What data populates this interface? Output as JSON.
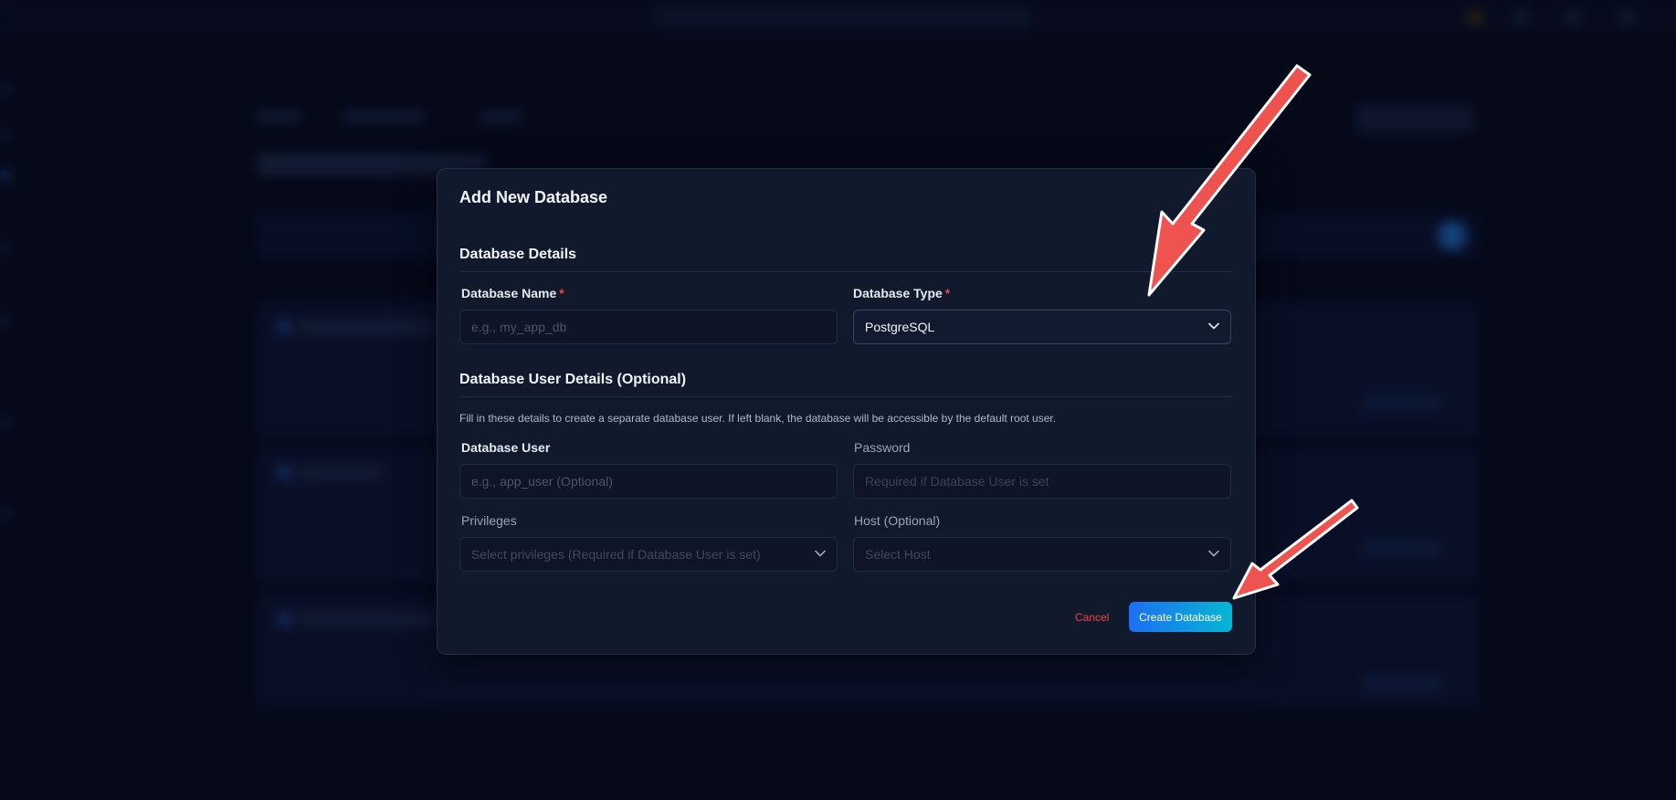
{
  "modal": {
    "title": "Add New Database",
    "details_section": {
      "title": "Database Details",
      "name_label": "Database Name",
      "name_placeholder": "e.g., my_app_db",
      "type_label": "Database Type",
      "type_value": "PostgreSQL",
      "required_mark": "*"
    },
    "user_section": {
      "title": "Database User Details (Optional)",
      "helper": "Fill in these details to create a separate database user. If left blank, the database will be accessible by the default root user.",
      "user_label": "Database User",
      "user_placeholder": "e.g., app_user (Optional)",
      "password_label": "Password",
      "password_placeholder": "Required if Database User is set",
      "privileges_label": "Privileges",
      "privileges_placeholder": "Select privileges (Required if Database User is set)",
      "host_label": "Host (Optional)",
      "host_placeholder": "Select Host"
    },
    "actions": {
      "cancel": "Cancel",
      "create": "Create Database"
    }
  },
  "colors": {
    "accent_gradient_start": "#1d6ff2",
    "accent_gradient_end": "#06b6d4",
    "danger": "#ef4444",
    "annotation_arrow": "#ef5350"
  },
  "icons": {
    "select_chevron": "chevron-down-icon",
    "annotation": "arrow-icon"
  }
}
